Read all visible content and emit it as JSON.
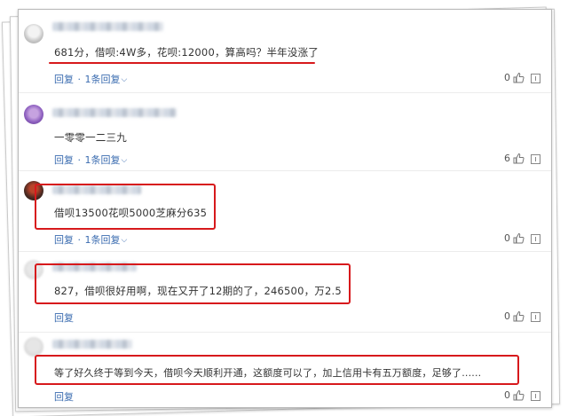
{
  "comments": [
    {
      "text": "681分，借呗:4W多，花呗:12000，算高吗？半年没涨了",
      "reply_label": "回复",
      "replies_label": "1条回复",
      "likes": "0"
    },
    {
      "text": "一零零一二三九",
      "reply_label": "回复",
      "replies_label": "1条回复",
      "likes": "6"
    },
    {
      "text": "借呗13500花呗5000芝麻分635",
      "reply_label": "回复",
      "replies_label": "1条回复",
      "likes": "0"
    },
    {
      "text": "827，借呗很好用啊，现在又开了12期的了，246500，万2.5",
      "reply_label": "回复",
      "likes": "0"
    },
    {
      "text": "等了好久终于等到今天，借呗今天顺利开通，这额度可以了，加上信用卡有五万额度，足够了......",
      "reply_label": "回复",
      "likes": "0"
    }
  ],
  "separator": "·",
  "colors": {
    "link": "#3b6cb0",
    "highlight": "#d7191c",
    "text": "#333333"
  },
  "icons": {
    "like": "thumbs-up-icon",
    "report": "report-icon",
    "expand": "chevron-down-icon"
  }
}
